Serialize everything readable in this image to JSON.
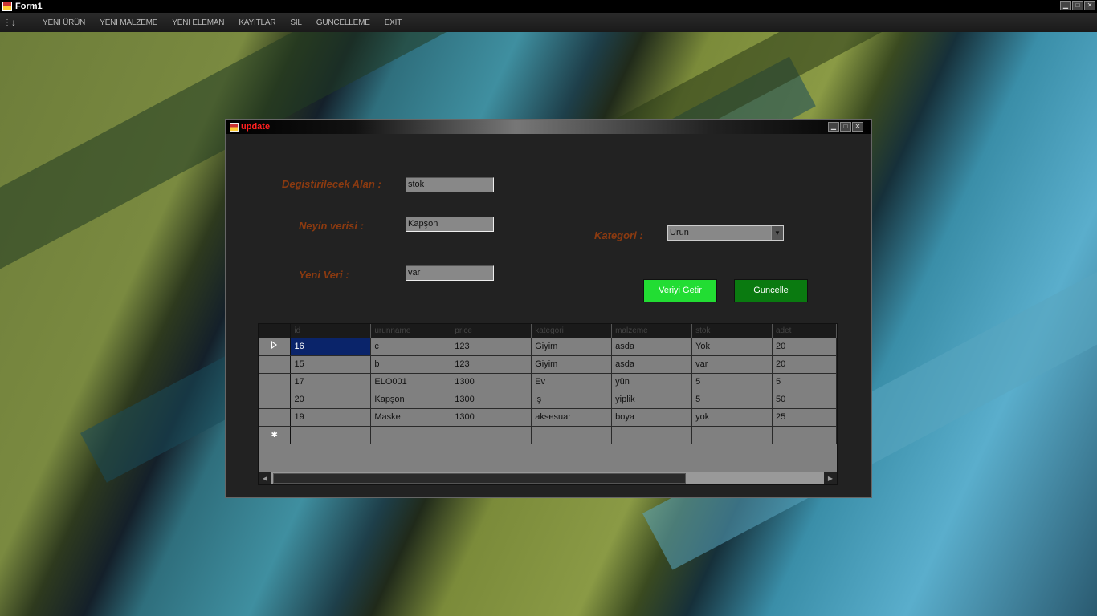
{
  "window": {
    "title": "Form1"
  },
  "menu": {
    "items": [
      "YENİ ÜRÜN",
      "YENİ MALZEME",
      "YENİ ELEMAN",
      "KAYITLAR",
      "SİL",
      "GUNCELLEME",
      "EXIT"
    ]
  },
  "dialog": {
    "title": "update",
    "labels": {
      "field": "Degistirilecek Alan :",
      "of_what": "Neyin verisi :",
      "new_value": "Yeni Veri :",
      "category": "Kategori :"
    },
    "inputs": {
      "field": "stok",
      "of_what": "Kapşon",
      "new_value": "var",
      "category": "Urun"
    },
    "buttons": {
      "fetch": "Veriyi Getir",
      "update": "Guncelle"
    }
  },
  "grid": {
    "columns": [
      "id",
      "urunname",
      "price",
      "kategori",
      "malzeme",
      "stok",
      "adet"
    ],
    "rows": [
      [
        "16",
        "c",
        "123",
        "Giyim",
        "asda",
        "Yok",
        "20"
      ],
      [
        "15",
        "b",
        "123",
        "Giyim",
        "asda",
        "var",
        "20"
      ],
      [
        "17",
        "ELO001",
        "1300",
        "Ev",
        "yün",
        "5",
        "5"
      ],
      [
        "20",
        "Kapşon",
        "1300",
        "iş",
        "yiplik",
        "5",
        "50"
      ],
      [
        "19",
        "Maske",
        "1300",
        "aksesuar",
        "boya",
        "yok",
        "25"
      ]
    ]
  },
  "colors": {
    "label": "#8b3a10",
    "fetch_button": "#22dd33",
    "update_button": "#0a7a10",
    "dialog_title": "#ff2020",
    "selected_cell": "#0a246a"
  }
}
